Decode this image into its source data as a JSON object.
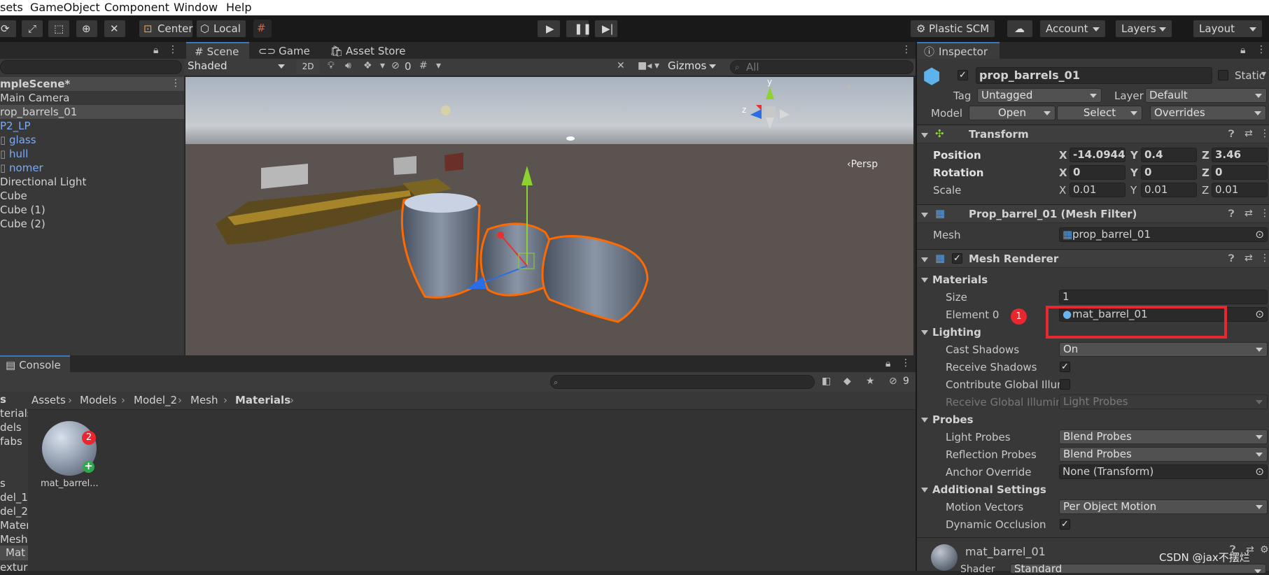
{
  "menu": [
    "sets",
    "GameObject",
    "Component",
    "Window",
    "Help"
  ],
  "toolbar": {
    "center": "Center",
    "local": "Local",
    "plastic": "Plastic SCM",
    "account": "Account",
    "layers": "Layers",
    "layout": "Layout"
  },
  "hierarchy": {
    "scene": "mpleScene*",
    "items": [
      "Main Camera",
      "rop_barrels_01",
      "P2_LP",
      "glass",
      "hull",
      "nomer",
      "Directional Light",
      "Cube",
      "Cube (1)",
      "Cube (2)"
    ]
  },
  "scene": {
    "tabs": [
      "Scene",
      "Game",
      "Asset Store"
    ],
    "shading": "Shaded",
    "mode2d": "2D",
    "hidden_count": "0",
    "gizmos": "Gizmos",
    "search_placeholder": "All",
    "persp": "‹Persp",
    "axis_y": "y",
    "axis_z": "z"
  },
  "console": {
    "tab": "Console",
    "hidden_count": "9"
  },
  "project": {
    "breadcrumb": [
      "Assets",
      "Models",
      "Model_2",
      "Mesh",
      "Materials"
    ],
    "left_items": [
      "s",
      "terials",
      "dels",
      "fabs",
      "",
      "s",
      "del_1",
      "del_2",
      "Materi",
      "Mesh",
      "Mat",
      "extur"
    ],
    "asset_label": "mat_barrel...",
    "badge2": "2"
  },
  "inspector": {
    "tab": "Inspector",
    "object_name": "prop_barrels_01",
    "static": "Static",
    "tag_label": "Tag",
    "tag_value": "Untagged",
    "layer_label": "Layer",
    "layer_value": "Default",
    "model_label": "Model",
    "open": "Open",
    "select": "Select",
    "overrides": "Overrides",
    "transform": {
      "title": "Transform",
      "position_label": "Position",
      "rotation_label": "Rotation",
      "scale_label": "Scale",
      "position": [
        "-14.0944",
        "0.4",
        "3.46"
      ],
      "rotation": [
        "0",
        "0",
        "0"
      ],
      "scale": [
        "0.01",
        "0.01",
        "0.01"
      ]
    },
    "mesh_filter": {
      "title": "Prop_barrel_01 (Mesh Filter)",
      "mesh_label": "Mesh",
      "mesh_value": "prop_barrel_01"
    },
    "mesh_renderer": {
      "title": "Mesh Renderer",
      "materials": "Materials",
      "size_label": "Size",
      "size_value": "1",
      "element0_label": "Element 0",
      "element0_value": "mat_barrel_01",
      "badge1": "1",
      "lighting": "Lighting",
      "cast_shadows_label": "Cast Shadows",
      "cast_shadows_value": "On",
      "receive_shadows_label": "Receive Shadows",
      "contribute_gi_label": "Contribute Global Illun",
      "receive_gi_label": "Receive Global Illumin",
      "receive_gi_value": "Light Probes",
      "probes": "Probes",
      "light_probes_label": "Light Probes",
      "light_probes_value": "Blend Probes",
      "reflection_probes_label": "Reflection Probes",
      "reflection_probes_value": "Blend Probes",
      "anchor_label": "Anchor Override",
      "anchor_value": "None (Transform)",
      "additional": "Additional Settings",
      "motion_label": "Motion Vectors",
      "motion_value": "Per Object Motion",
      "occlusion_label": "Dynamic Occlusion"
    },
    "material": {
      "name": "mat_barrel_01",
      "shader_label": "Shader",
      "shader_value": "Standard"
    },
    "watermark": "CSDN @jax不摆烂"
  },
  "colors": {
    "accent": "#3a79bb",
    "highlight": "#e8282e",
    "selection": "#ff6a00"
  }
}
